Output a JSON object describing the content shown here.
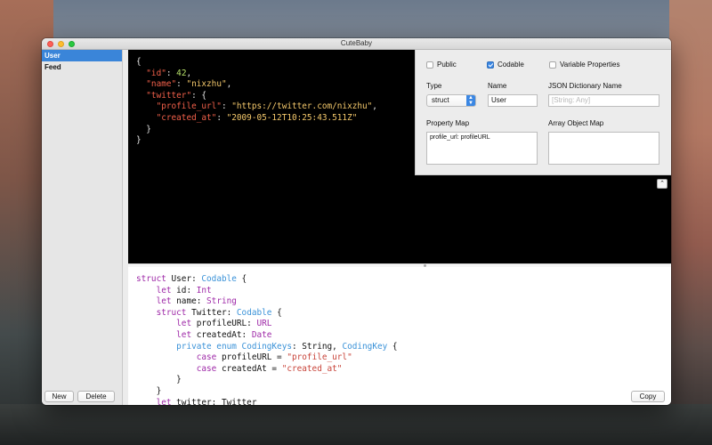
{
  "window": {
    "title": "CuteBaby"
  },
  "sidebar": {
    "items": [
      {
        "label": "User",
        "selected": true
      },
      {
        "label": "Feed",
        "selected": false
      }
    ],
    "buttons": {
      "new": "New",
      "delete": "Delete"
    }
  },
  "json_editor": {
    "lines": [
      "{",
      "  \"id\": 42,",
      "  \"name\": \"nixzhu\",",
      "  \"twitter\": {",
      "    \"profile_url\": \"https://twitter.com/nixzhu\",",
      "    \"created_at\": \"2009-05-12T10:25:43.511Z\"",
      "  }",
      "}"
    ]
  },
  "properties": {
    "public_label": "Public",
    "public_checked": false,
    "codable_label": "Codable",
    "codable_checked": true,
    "variable_label": "Variable Properties",
    "variable_checked": false,
    "type_label": "Type",
    "type_value": "struct",
    "name_label": "Name",
    "name_value": "User",
    "json_dict_label": "JSON Dictionary Name",
    "json_dict_placeholder": "[String: Any]",
    "property_map_label": "Property Map",
    "property_map_value": "profile_url: profileURL",
    "array_map_label": "Array Object Map",
    "array_map_value": ""
  },
  "swift_output": {
    "lines": [
      "struct User: Codable {",
      "    let id: Int",
      "    let name: String",
      "    struct Twitter: Codable {",
      "        let profileURL: URL",
      "        let createdAt: Date",
      "        private enum CodingKeys: String, CodingKey {",
      "            case profileURL = \"profile_url\"",
      "            case createdAt = \"created_at\"",
      "        }",
      "    }",
      "    let twitter: Twitter",
      "}"
    ],
    "copy_label": "Copy"
  },
  "colors": {
    "selection": "#3a85d9",
    "json_key": "#f2604a",
    "json_number": "#b6e169",
    "json_string": "#f4c86b",
    "swift_keyword": "#9f2aa8",
    "swift_type": "#3a92d8",
    "swift_string": "#c8443a"
  },
  "icons": {
    "collapse": "chevron-up-icon",
    "select": "updown-arrows-icon"
  }
}
